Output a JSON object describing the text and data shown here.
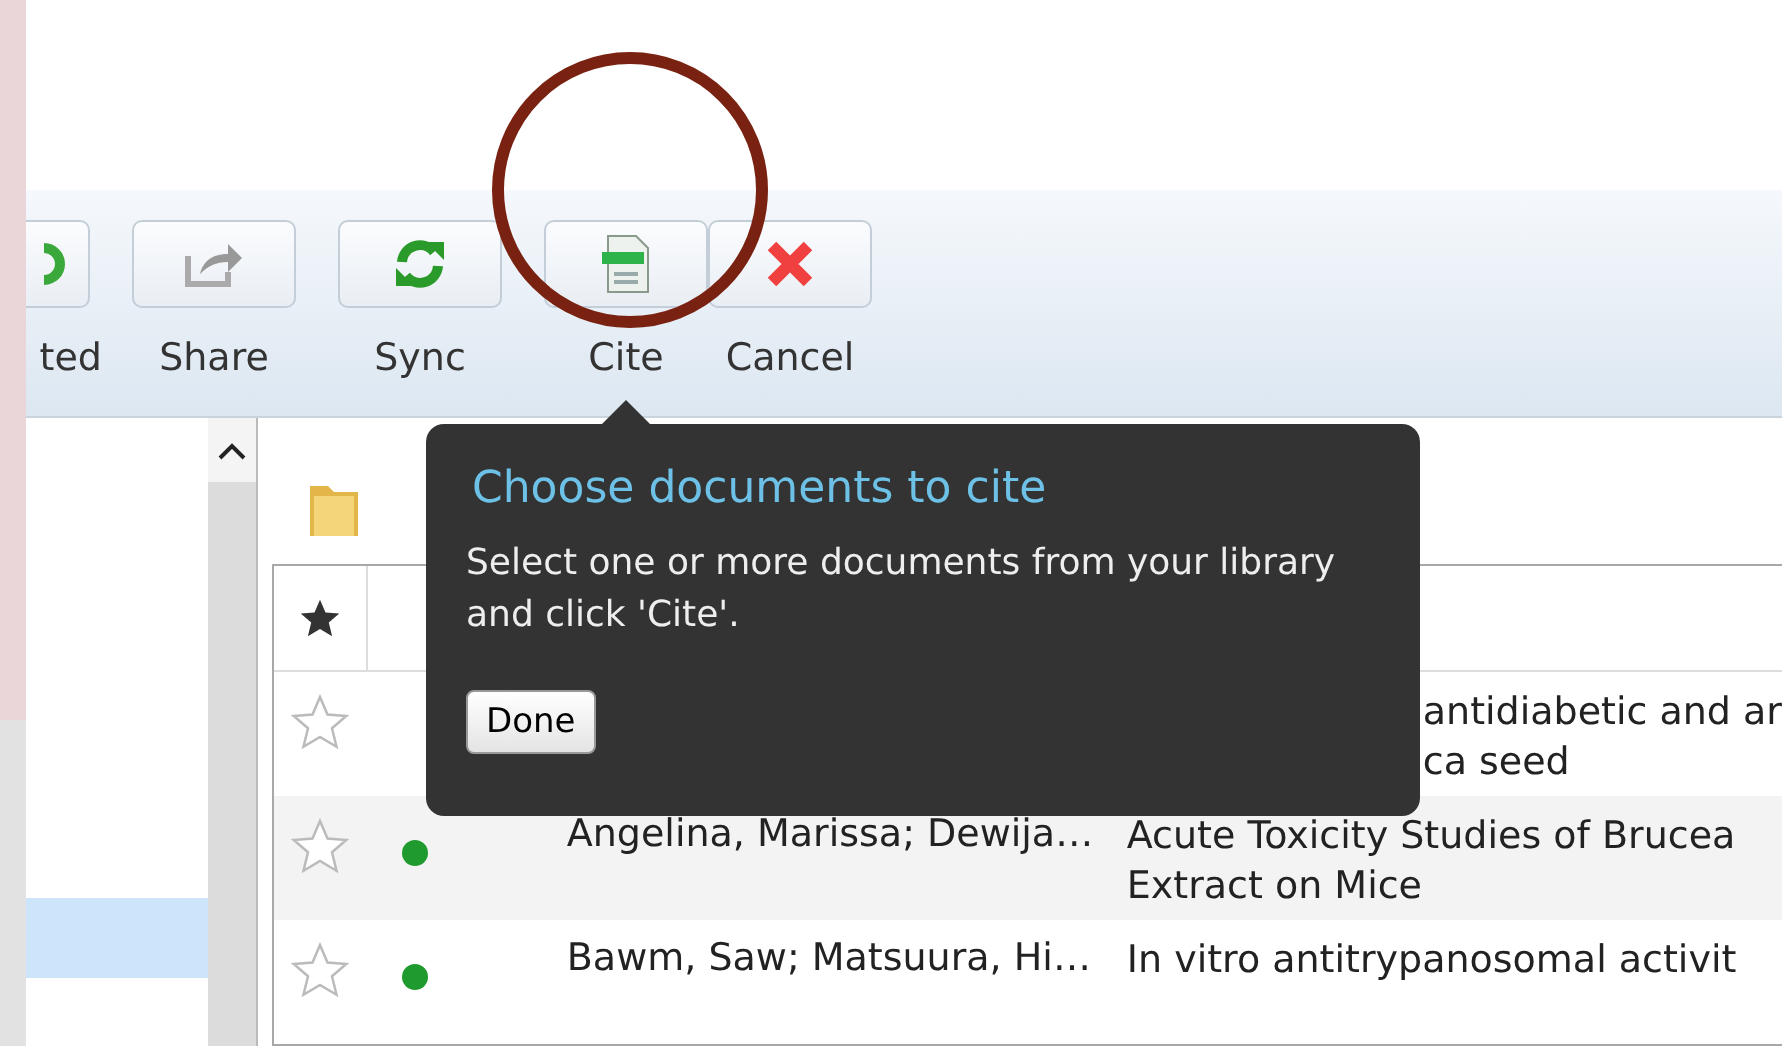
{
  "toolbar": {
    "buttons": [
      {
        "kind": "partial",
        "label": "ted"
      },
      {
        "kind": "share",
        "label": "Share"
      },
      {
        "kind": "sync",
        "label": "Sync"
      },
      {
        "kind": "cite",
        "label": "Cite"
      },
      {
        "kind": "cancel",
        "label": "Cancel"
      }
    ]
  },
  "sidebar": {
    "items": [
      {
        "selected": true
      }
    ]
  },
  "table": {
    "rows": [
      {
        "kind": "covered",
        "starred": false,
        "title_lines": [
          "antidiabetic and ar",
          "ca seed"
        ]
      },
      {
        "kind": "plain",
        "starred": false,
        "unread": true,
        "authors": "Angelina, Marissa; Dewija…",
        "title_lines": [
          "Acute Toxicity Studies of Brucea",
          "Extract on Mice"
        ]
      },
      {
        "kind": "plain",
        "starred": false,
        "unread": true,
        "authors": "Bawm, Saw; Matsuura, Hi…",
        "title_lines": [
          "In vitro antitrypanosomal activit"
        ]
      }
    ]
  },
  "tooltip": {
    "title": "Choose documents to cite",
    "text": "Select one or more documents from your library and click 'Cite'.",
    "button": "Done"
  }
}
